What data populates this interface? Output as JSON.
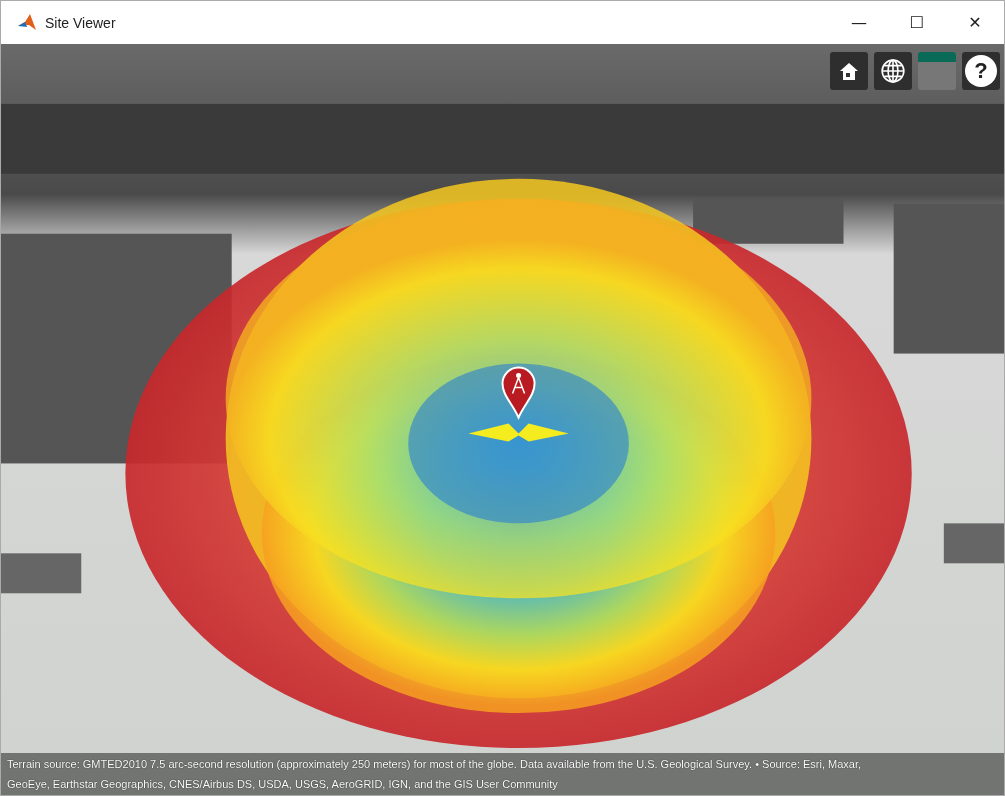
{
  "window": {
    "title": "Site Viewer",
    "controls": [
      "—",
      "☐",
      "✕"
    ]
  },
  "toolbar": [
    {
      "kind": "home"
    },
    {
      "kind": "globe"
    },
    {
      "kind": "basemap"
    },
    {
      "kind": "help",
      "label": "?"
    }
  ],
  "attribution": [
    "Terrain source: GMTED2010 7.5 arc-second resolution (approximately 250 meters) for most of the globe. Data available from the U.S. Geological Survey. • Source: Esri, Maxar,",
    "GeoEye, Earthstar Geographics, CNES/Airbus DS, USDA, USGS, AeroGRID, IGN, and the GIS User Community"
  ]
}
